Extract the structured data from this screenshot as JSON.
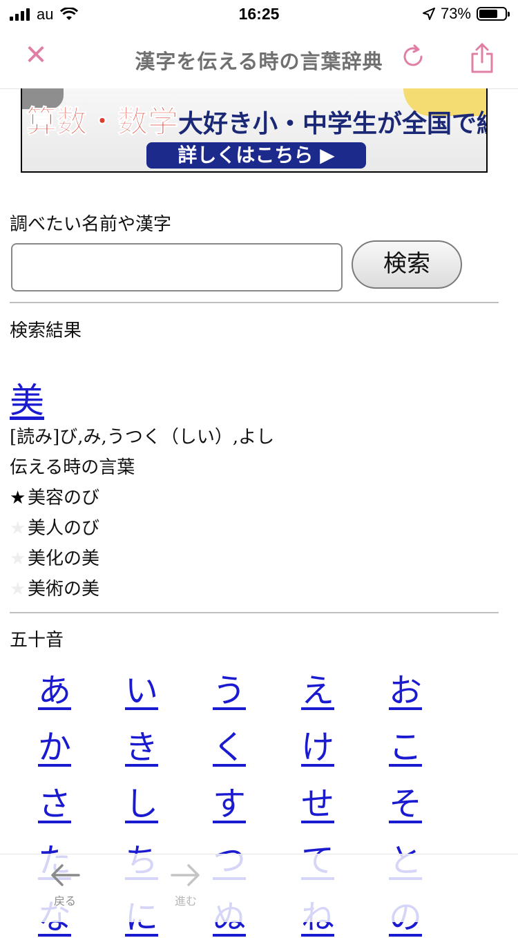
{
  "status_bar": {
    "carrier": "au",
    "time": "16:25",
    "battery": "73%",
    "battery_level": 0.73
  },
  "navbar": {
    "title": "漢字を伝える時の言葉辞典"
  },
  "ad": {
    "headline_red": "算数・数学",
    "headline_navy": "大好き小・中学生が全国で続出!",
    "cta": "詳しくはこちら ▶"
  },
  "search": {
    "label": "調べたい名前や漢字",
    "value": "",
    "button": "検索"
  },
  "results": {
    "label": "検索結果",
    "kanji": "美",
    "reading": "[読み]び,み,うつく（しい）,よし",
    "words_label": "伝える時の言葉",
    "words": [
      {
        "text": "美容のび",
        "star": "★",
        "highlighted": true
      },
      {
        "text": "美人のび",
        "star": "★",
        "highlighted": false
      },
      {
        "text": "美化の美",
        "star": "★",
        "highlighted": false
      },
      {
        "text": "美術の美",
        "star": "★",
        "highlighted": false
      }
    ]
  },
  "gojuon": {
    "label": "五十音",
    "rows": [
      [
        "あ",
        "い",
        "う",
        "え",
        "お"
      ],
      [
        "か",
        "き",
        "く",
        "け",
        "こ"
      ],
      [
        "さ",
        "し",
        "す",
        "せ",
        "そ"
      ],
      [
        "た",
        "ち",
        "つ",
        "て",
        "と"
      ],
      [
        "な",
        "に",
        "ぬ",
        "ね",
        "の"
      ]
    ]
  },
  "toolbar": {
    "back": "戻る",
    "forward": "進む"
  },
  "colors": {
    "accent_pink": "#e07fa6",
    "link_blue": "#1a1ad0",
    "ad_red": "#e03a2c",
    "ad_navy": "#1c2a8c"
  }
}
